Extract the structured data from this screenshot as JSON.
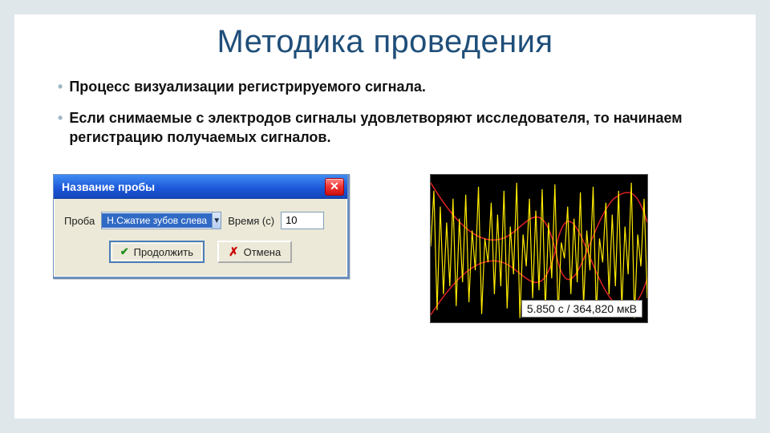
{
  "title": "Методика проведения",
  "bullets": [
    "Процесс визуализации регистрируемого сигнала.",
    "Если снимаемые с электродов сигналы удовлетворяют исследователя, то начинаем регистрацию получаемых сигналов."
  ],
  "dialog": {
    "title": "Название пробы",
    "labels": {
      "proba": "Проба",
      "time": "Время (с)"
    },
    "proba_value": "Н.Сжатие зубов слева",
    "time_value": "10",
    "buttons": {
      "continue": "Продолжить",
      "cancel": "Отмена"
    }
  },
  "plot": {
    "readout": "5.850 с / 364,820 мкВ"
  }
}
